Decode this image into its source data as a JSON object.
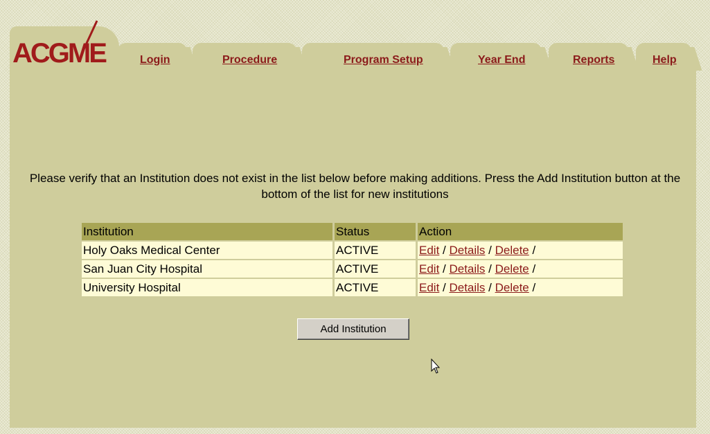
{
  "logo": {
    "text": "ACGME"
  },
  "nav": {
    "login": "Login",
    "procedure": "Procedure",
    "program_setup": "Program Setup",
    "year_end": "Year End",
    "reports": "Reports",
    "help": "Help"
  },
  "instructions": "Please verify that an Institution does not exist in the list below before making additions. Press the Add Institution button at the bottom of the list for new institutions",
  "table": {
    "headers": [
      "Institution",
      "Status",
      "Action"
    ],
    "rows": [
      {
        "institution": "Holy Oaks Medical Center",
        "status": "ACTIVE"
      },
      {
        "institution": "San Juan City Hospital",
        "status": "ACTIVE"
      },
      {
        "institution": "University Hospital",
        "status": "ACTIVE"
      }
    ],
    "actions": {
      "edit": "Edit",
      "details": "Details",
      "delete": "Delete",
      "separator": " / ",
      "trailing": " /"
    }
  },
  "add_button": "Add Institution",
  "colors": {
    "panel": "#cfcd9c",
    "header": "#a8a555",
    "row": "#fefbd6",
    "link": "#8b1a1a"
  }
}
